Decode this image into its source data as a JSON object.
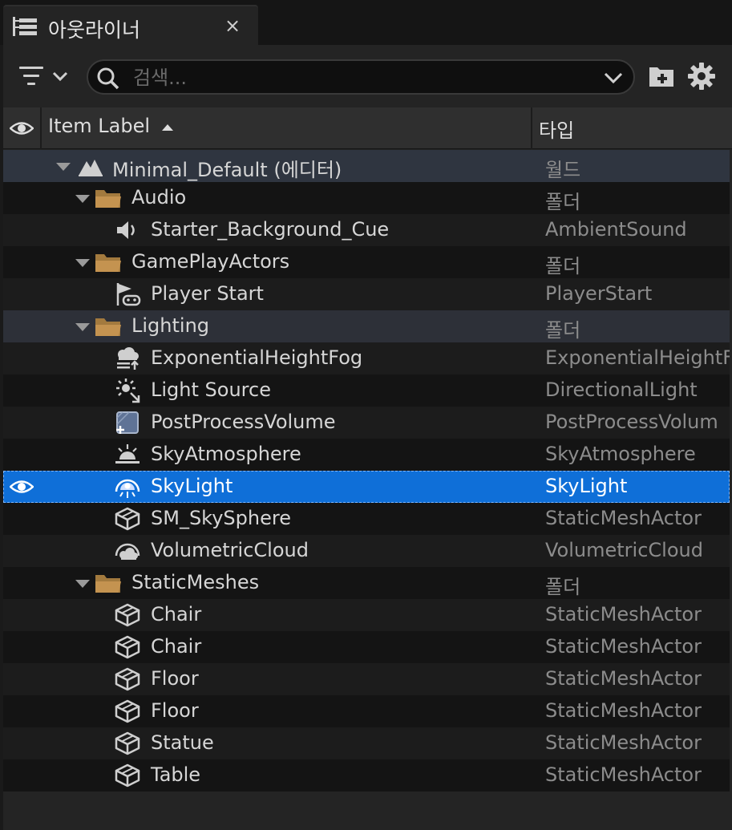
{
  "tab": {
    "title": "아웃라이너",
    "close": "×"
  },
  "search": {
    "placeholder": "검색...",
    "value": ""
  },
  "header": {
    "label_col": "Item Label",
    "type_col": "타입"
  },
  "rows": [
    {
      "label": "Minimal_Default (에디터)",
      "type": "월드",
      "icon": "world-icon",
      "indent": 0,
      "expandable": true
    },
    {
      "label": "Audio",
      "type": "폴더",
      "icon": "folder-icon",
      "indent": 1,
      "expandable": true
    },
    {
      "label": "Starter_Background_Cue",
      "type": "AmbientSound",
      "icon": "speaker-icon",
      "indent": 2
    },
    {
      "label": "GamePlayActors",
      "type": "폴더",
      "icon": "folder-icon",
      "indent": 1,
      "expandable": true
    },
    {
      "label": "Player Start",
      "type": "PlayerStart",
      "icon": "player-start-icon",
      "indent": 2
    },
    {
      "label": "Lighting",
      "type": "폴더",
      "icon": "folder-icon",
      "indent": 1,
      "expandable": true
    },
    {
      "label": "ExponentialHeightFog",
      "type": "ExponentialHeightF",
      "icon": "fog-icon",
      "indent": 2
    },
    {
      "label": "Light Source",
      "type": "DirectionalLight",
      "icon": "directional-light-icon",
      "indent": 2
    },
    {
      "label": "PostProcessVolume",
      "type": "PostProcessVolum",
      "icon": "post-process-icon",
      "indent": 2
    },
    {
      "label": "SkyAtmosphere",
      "type": "SkyAtmosphere",
      "icon": "sky-atmosphere-icon",
      "indent": 2
    },
    {
      "label": "SkyLight",
      "type": "SkyLight",
      "icon": "skylight-icon",
      "indent": 2,
      "selected": true
    },
    {
      "label": "SM_SkySphere",
      "type": "StaticMeshActor",
      "icon": "static-mesh-icon",
      "indent": 2
    },
    {
      "label": "VolumetricCloud",
      "type": "VolumetricCloud",
      "icon": "volumetric-cloud-icon",
      "indent": 2
    },
    {
      "label": "StaticMeshes",
      "type": "폴더",
      "icon": "folder-icon",
      "indent": 1,
      "expandable": true
    },
    {
      "label": "Chair",
      "type": "StaticMeshActor",
      "icon": "static-mesh-icon",
      "indent": 2
    },
    {
      "label": "Chair",
      "type": "StaticMeshActor",
      "icon": "static-mesh-icon",
      "indent": 2
    },
    {
      "label": "Floor",
      "type": "StaticMeshActor",
      "icon": "static-mesh-icon",
      "indent": 2
    },
    {
      "label": "Floor",
      "type": "StaticMeshActor",
      "icon": "static-mesh-icon",
      "indent": 2
    },
    {
      "label": "Statue",
      "type": "StaticMeshActor",
      "icon": "static-mesh-icon",
      "indent": 2
    },
    {
      "label": "Table",
      "type": "StaticMeshActor",
      "icon": "static-mesh-icon",
      "indent": 2
    }
  ]
}
